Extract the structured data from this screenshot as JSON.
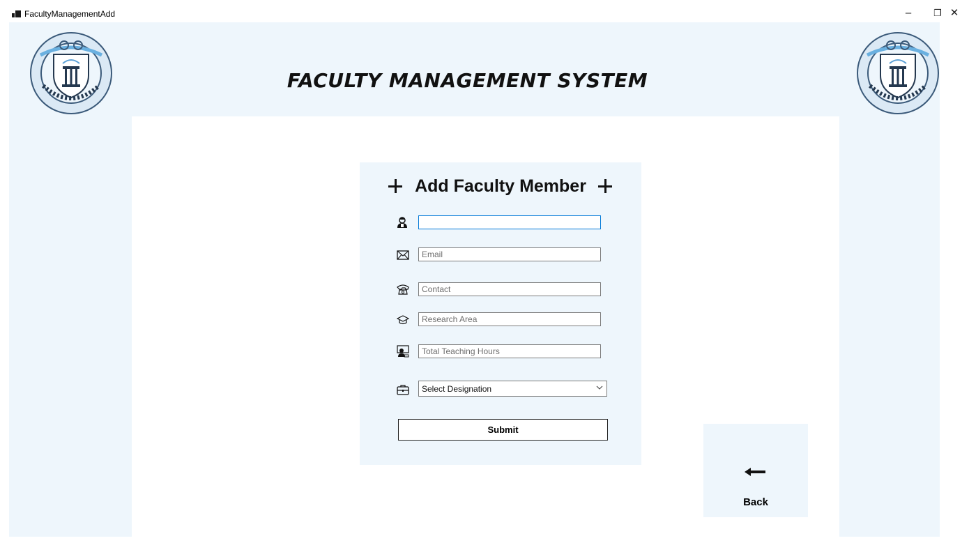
{
  "window": {
    "title": "FacultyManagementAdd",
    "minimize_glyph": "–",
    "maximize_glyph": "❐",
    "close_glyph": "✕"
  },
  "header": {
    "title": "FACULTY MANAGEMENT SYSTEM",
    "logo_text": "FACULTY MANAGEMENT SYSTEM"
  },
  "form": {
    "title": "Add Faculty Member",
    "fields": {
      "name": {
        "value": "",
        "placeholder": "",
        "icon": "teacher-icon"
      },
      "email": {
        "value": "",
        "placeholder": "Email",
        "icon": "envelope-icon"
      },
      "contact": {
        "value": "",
        "placeholder": "Contact",
        "icon": "telephone-icon"
      },
      "research": {
        "value": "",
        "placeholder": "Research Area",
        "icon": "graduation-cap-icon"
      },
      "hours": {
        "value": "",
        "placeholder": "Total Teaching Hours",
        "icon": "teacher-board-icon"
      }
    },
    "designation": {
      "selected": "Select Designation",
      "icon": "briefcase-icon"
    },
    "submit_label": "Submit"
  },
  "back": {
    "label": "Back",
    "icon": "arrow-left-icon"
  },
  "colors": {
    "panel_bg": "#eef6fc",
    "focus_border": "#0078d7"
  }
}
